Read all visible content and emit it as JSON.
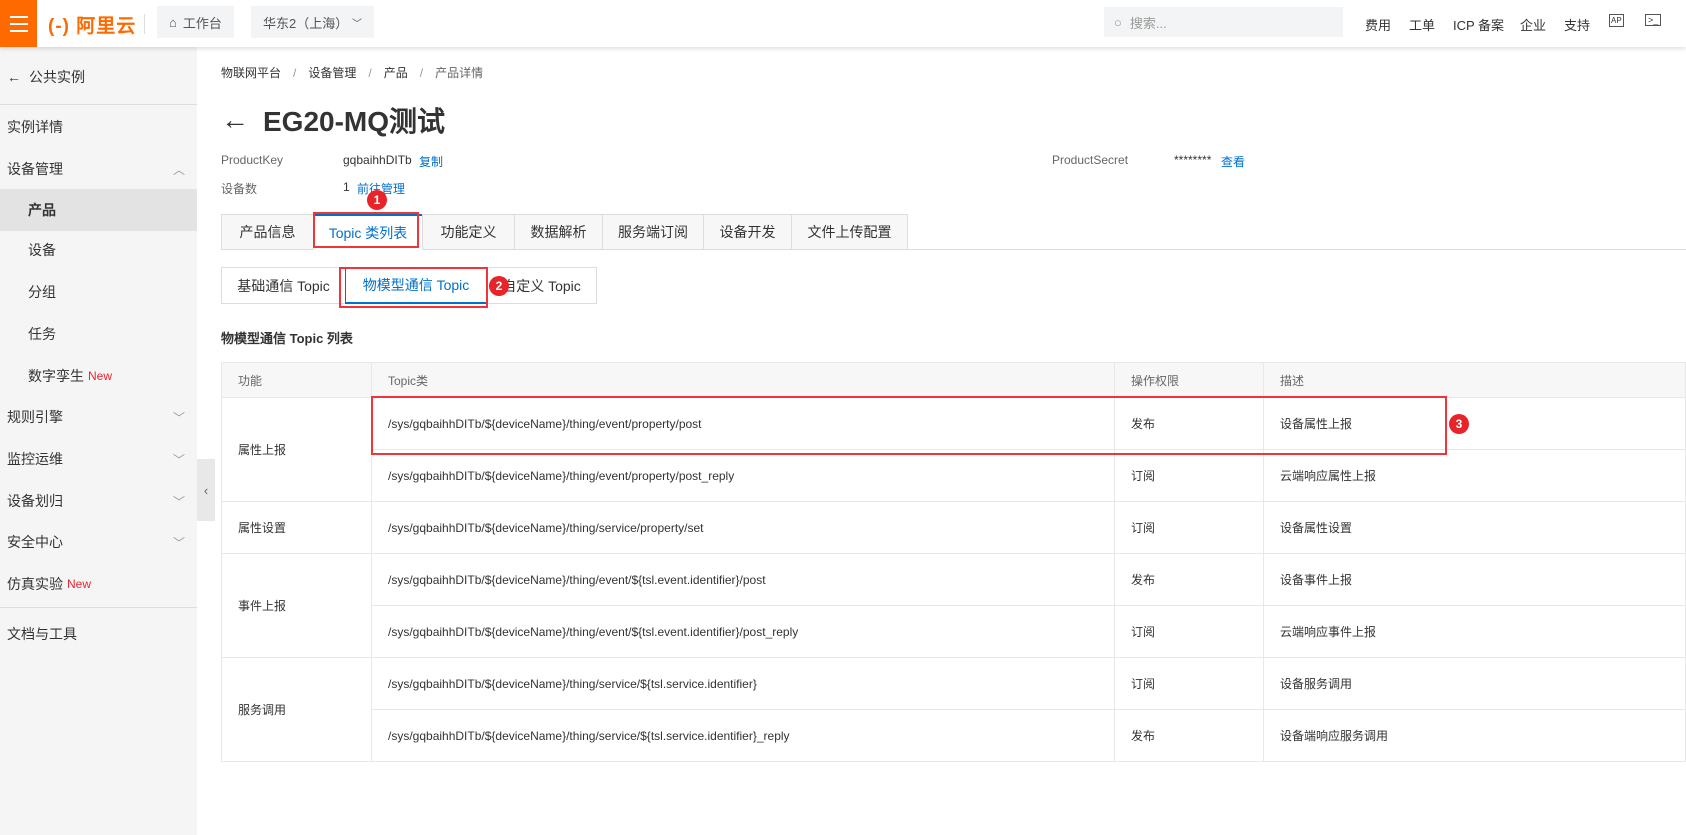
{
  "topbar": {
    "logo": "(-) 阿里云",
    "workbench": "工作台",
    "region": "华东2（上海）",
    "search_placeholder": "搜索...",
    "links": [
      "费用",
      "工单",
      "ICP 备案",
      "企业",
      "支持"
    ]
  },
  "sidebar": {
    "back": "公共实例",
    "items": [
      {
        "label": "实例详情"
      },
      {
        "label": "设备管理",
        "expanded": true
      },
      {
        "label": "产品",
        "active": true
      },
      {
        "label": "设备"
      },
      {
        "label": "分组"
      },
      {
        "label": "任务"
      },
      {
        "label": "数字孪生",
        "badge": "New"
      },
      {
        "label": "规则引擎"
      },
      {
        "label": "监控运维"
      },
      {
        "label": "设备划归"
      },
      {
        "label": "安全中心"
      },
      {
        "label": "仿真实验",
        "badge": "New"
      },
      {
        "label": "文档与工具"
      }
    ]
  },
  "breadcrumb": [
    "物联网平台",
    "设备管理",
    "产品",
    "产品详情"
  ],
  "page": {
    "title": "EG20-MQ测试",
    "product_key_label": "ProductKey",
    "product_key": "gqbaihhDITb",
    "copy": "复制",
    "device_count_label": "设备数",
    "device_count": "1",
    "manage": "前往管理",
    "product_secret_label": "ProductSecret",
    "product_secret": "********",
    "view": "查看"
  },
  "tabs": [
    "产品信息",
    "Topic 类列表",
    "功能定义",
    "数据解析",
    "服务端订阅",
    "设备开发",
    "文件上传配置"
  ],
  "active_tab": "Topic 类列表",
  "subtabs": [
    "基础通信 Topic",
    "物模型通信 Topic",
    "自定义 Topic"
  ],
  "active_subtab": "物模型通信 Topic",
  "section_title": "物模型通信 Topic 列表",
  "table": {
    "headers": [
      "功能",
      "Topic类",
      "操作权限",
      "描述"
    ],
    "groups": [
      {
        "function": "属性上报",
        "rows": [
          {
            "topic": "/sys/gqbaihhDITb/${deviceName}/thing/event/property/post",
            "perm": "发布",
            "desc": "设备属性上报"
          },
          {
            "topic": "/sys/gqbaihhDITb/${deviceName}/thing/event/property/post_reply",
            "perm": "订阅",
            "desc": "云端响应属性上报"
          }
        ]
      },
      {
        "function": "属性设置",
        "rows": [
          {
            "topic": "/sys/gqbaihhDITb/${deviceName}/thing/service/property/set",
            "perm": "订阅",
            "desc": "设备属性设置"
          }
        ]
      },
      {
        "function": "事件上报",
        "rows": [
          {
            "topic": "/sys/gqbaihhDITb/${deviceName}/thing/event/${tsl.event.identifier}/post",
            "perm": "发布",
            "desc": "设备事件上报"
          },
          {
            "topic": "/sys/gqbaihhDITb/${deviceName}/thing/event/${tsl.event.identifier}/post_reply",
            "perm": "订阅",
            "desc": "云端响应事件上报"
          }
        ]
      },
      {
        "function": "服务调用",
        "rows": [
          {
            "topic": "/sys/gqbaihhDITb/${deviceName}/thing/service/${tsl.service.identifier}",
            "perm": "订阅",
            "desc": "设备服务调用"
          },
          {
            "topic": "/sys/gqbaihhDITb/${deviceName}/thing/service/${tsl.service.identifier}_reply",
            "perm": "发布",
            "desc": "设备端响应服务调用"
          }
        ]
      }
    ]
  },
  "annotations": [
    "1",
    "2",
    "3"
  ],
  "colors": {
    "brand": "#ff6a00",
    "link": "#0070cc",
    "annotation": "#f0353a"
  }
}
